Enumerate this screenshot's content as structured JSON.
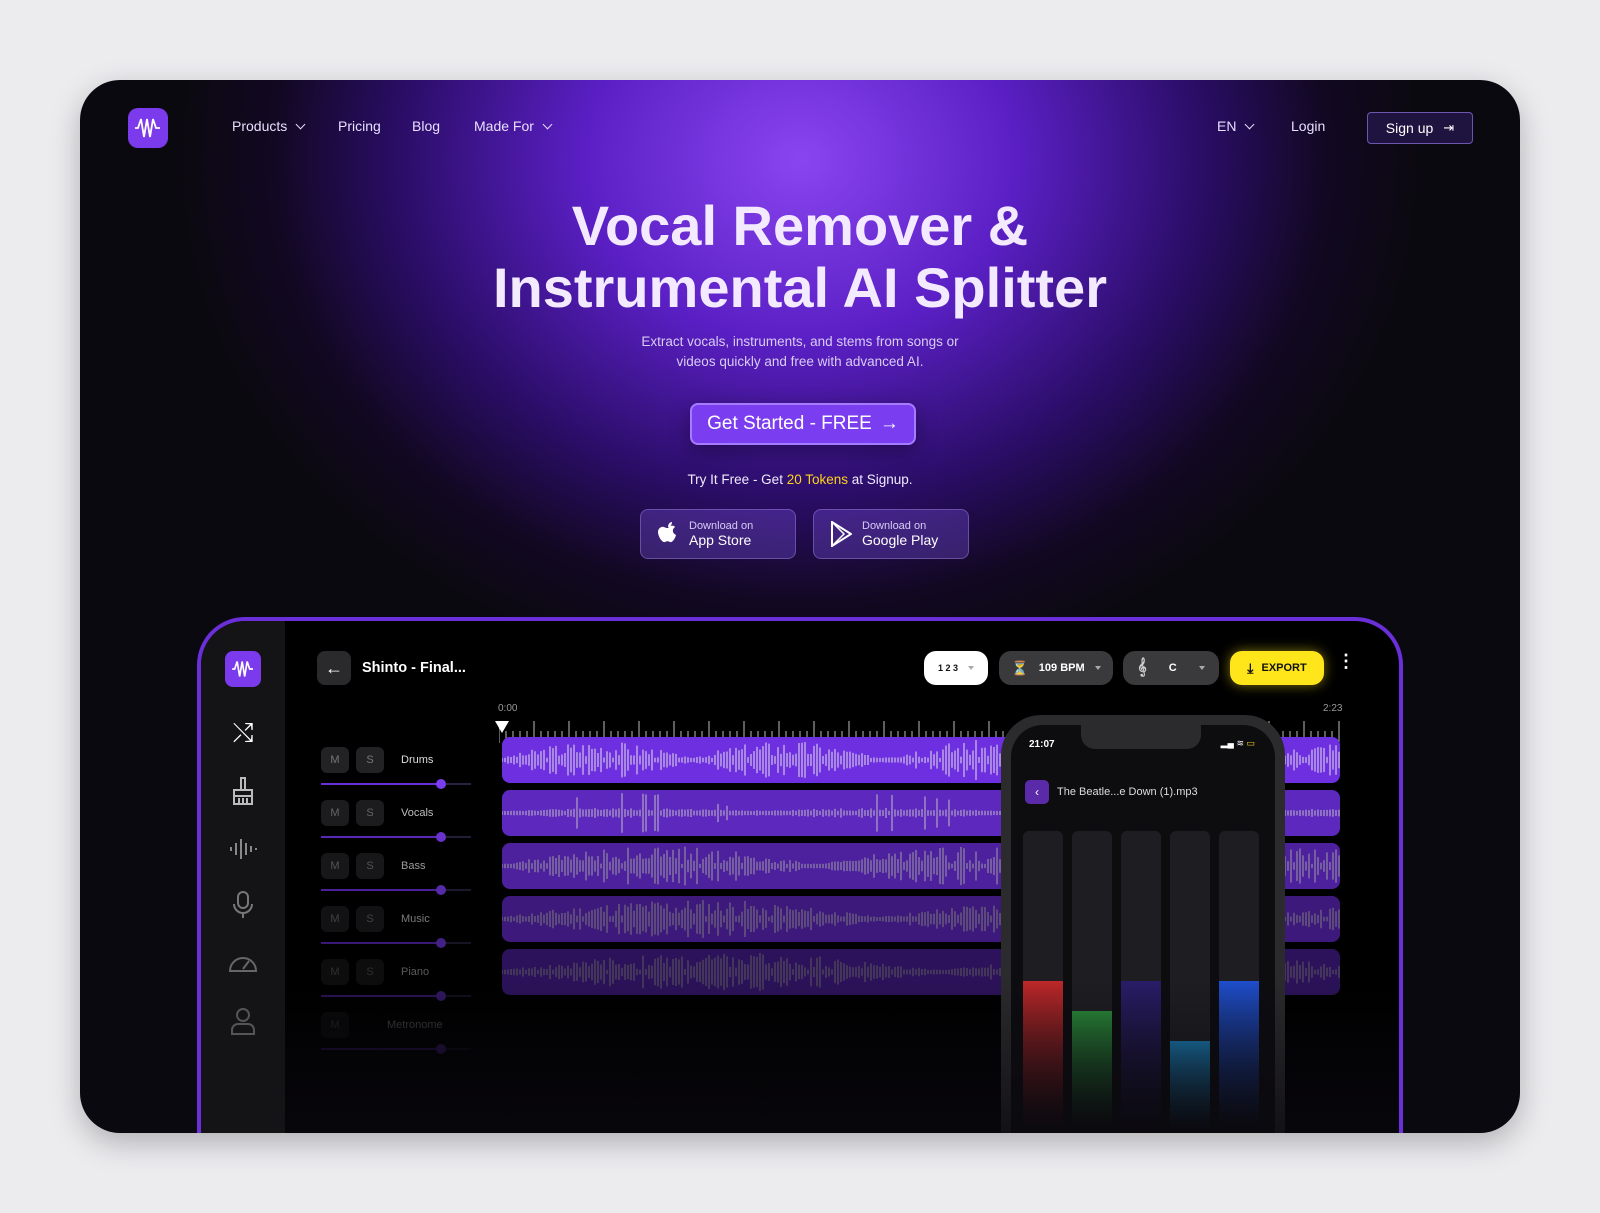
{
  "nav": {
    "products": "Products",
    "pricing": "Pricing",
    "blog": "Blog",
    "made_for": "Made For",
    "lang": "EN",
    "login": "Login",
    "signup": "Sign up"
  },
  "hero": {
    "title_line1": "Vocal Remover &",
    "title_line2": "Instrumental AI Splitter",
    "subtitle_line1": "Extract vocals, instruments, and stems from songs or",
    "subtitle_line2": "videos quickly and free with advanced AI.",
    "cta": "Get Started - FREE",
    "try_prefix": "Try It Free - Get ",
    "try_tokens": "20 Tokens",
    "try_suffix": " at Signup."
  },
  "stores": [
    {
      "small": "Download on",
      "name": "App Store"
    },
    {
      "small": "Download on",
      "name": "Google Play"
    }
  ],
  "app": {
    "title": "Shinto - Final...",
    "time_sig": "1 2 3",
    "bpm": "109 BPM",
    "key": "C",
    "export": "EXPORT",
    "time_start": "0:00",
    "time_end": "2:23",
    "tracks": [
      {
        "name": "Drums",
        "mute": "M",
        "solo": "S",
        "volume": 0.8
      },
      {
        "name": "Vocals",
        "mute": "M",
        "solo": "S",
        "volume": 0.8
      },
      {
        "name": "Bass",
        "mute": "M",
        "solo": "S",
        "volume": 0.8
      },
      {
        "name": "Music",
        "mute": "M",
        "solo": "S",
        "volume": 0.8
      },
      {
        "name": "Piano",
        "mute": "M",
        "solo": "S",
        "volume": 0.8
      },
      {
        "name": "Metronome",
        "mute": "M",
        "volume": 0.8
      }
    ]
  },
  "phone": {
    "time": "21:07",
    "file": "The Beatle...e Down (1).mp3",
    "meters": [
      {
        "color": "#c0282a",
        "level": 0.5
      },
      {
        "color": "#2a8a3a",
        "level": 0.4
      },
      {
        "color": "#2a1d6a",
        "level": 0.5
      },
      {
        "color": "#1a7ab0",
        "level": 0.3
      },
      {
        "color": "#1f4fd0",
        "level": 0.5
      }
    ]
  },
  "colors": {
    "accent": "#7b3df0",
    "export": "#ffe61a",
    "tokens": "#ffd21a"
  }
}
